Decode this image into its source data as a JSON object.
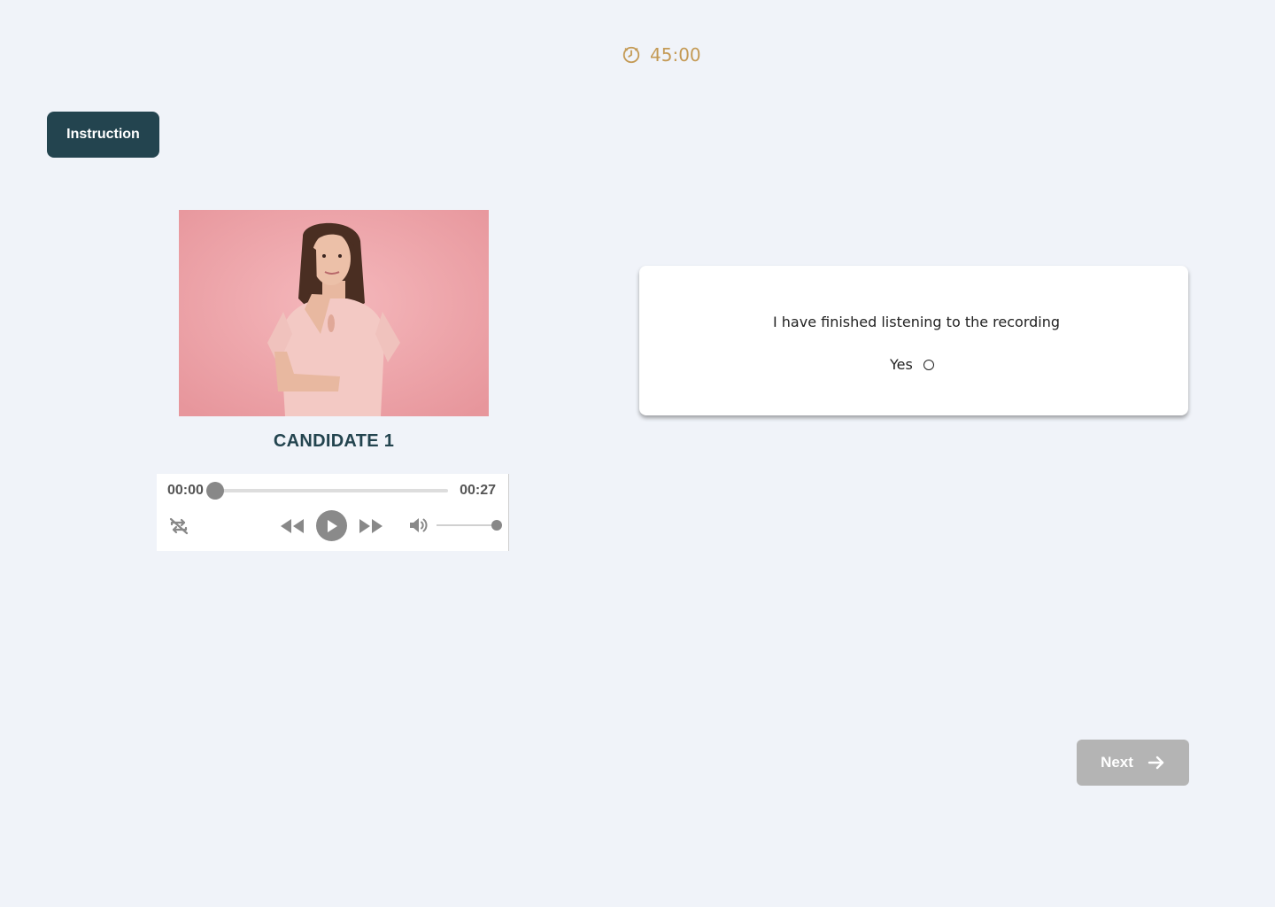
{
  "header": {
    "timer_text": "45:00",
    "timer_icon": "clock-icon",
    "timer_color": "#c49a55"
  },
  "instruction_button": {
    "label": "Instruction",
    "color": "#23444f"
  },
  "candidate": {
    "name": "CANDIDATE 1"
  },
  "audio_player": {
    "current_time": "00:00",
    "duration": "00:27",
    "progress": 0,
    "volume": 1.0,
    "icons": {
      "loop": "repeat-off-icon",
      "rewind": "rewind-icon",
      "play": "play-icon",
      "forward": "fast-forward-icon",
      "volume": "volume-icon"
    }
  },
  "confirmation": {
    "question": "I have finished listening to the recording",
    "option_label": "Yes",
    "selected": false
  },
  "next_button": {
    "label": "Next",
    "icon": "arrow-right-icon",
    "disabled": true,
    "color": "#b4b4b4"
  }
}
